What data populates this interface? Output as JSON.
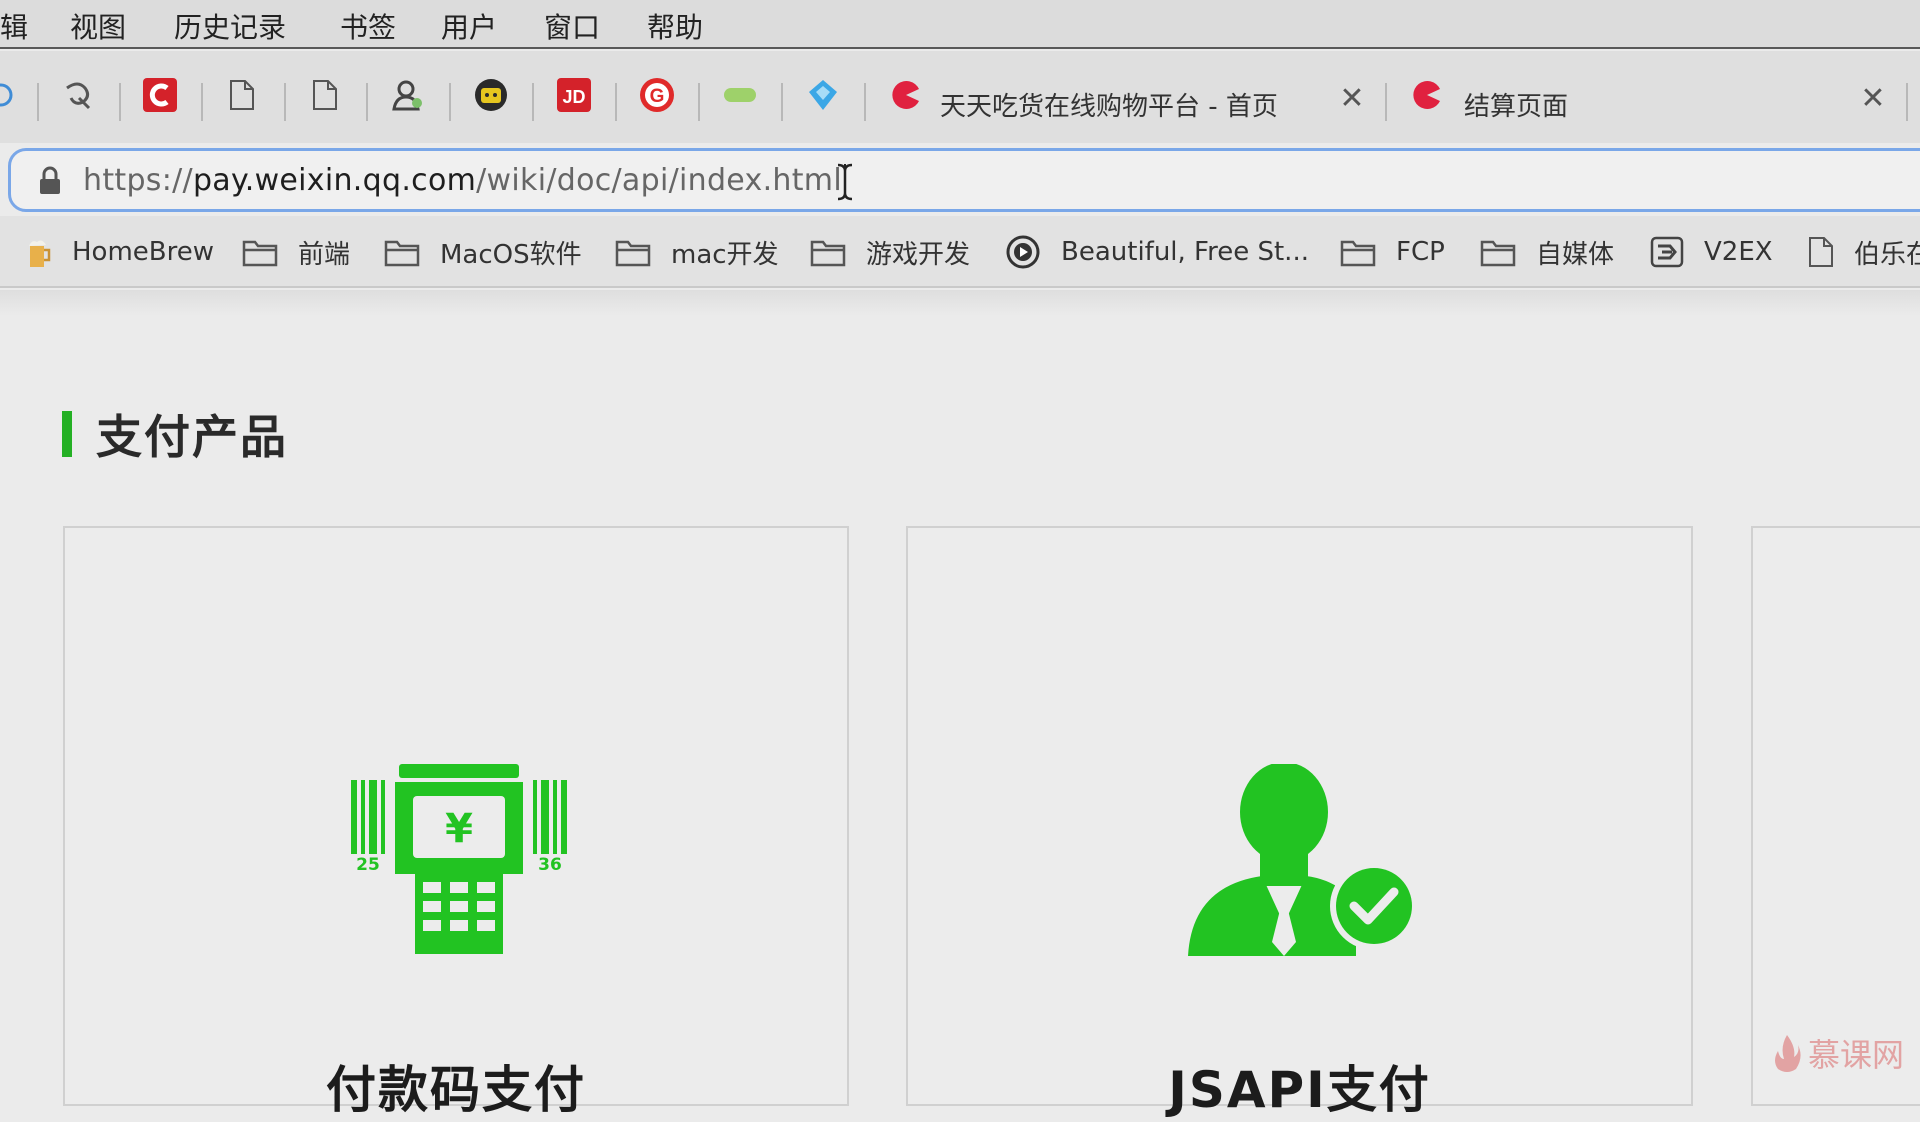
{
  "menubar": {
    "items": [
      "辑",
      "视图",
      "历史记录",
      "书签",
      "用户",
      "窗口",
      "帮助"
    ]
  },
  "tabs": [
    {
      "title": "天天吃货在线购物平台 - 首页",
      "close": "✕"
    },
    {
      "title": "结算页面",
      "close": "✕"
    }
  ],
  "address_bar": {
    "url_prefix": "https://",
    "url_host": "pay.weixin.qq.com",
    "url_path": "/wiki/doc/api/index.html"
  },
  "bookmarks": [
    {
      "label": "HomeBrew",
      "icon": "beer-icon"
    },
    {
      "label": "前端",
      "icon": "folder-icon"
    },
    {
      "label": "MacOS软件",
      "icon": "folder-icon"
    },
    {
      "label": "mac开发",
      "icon": "folder-icon"
    },
    {
      "label": "游戏开发",
      "icon": "folder-icon"
    },
    {
      "label": "Beautiful, Free St...",
      "icon": "play-circle-icon"
    },
    {
      "label": "FCP",
      "icon": "folder-icon"
    },
    {
      "label": "自媒体",
      "icon": "folder-icon"
    },
    {
      "label": "V2EX",
      "icon": "v2ex-icon"
    },
    {
      "label": "伯乐在",
      "icon": "page-icon"
    }
  ],
  "content": {
    "section_title": "支付产品",
    "cards": [
      {
        "title": "付款码支付",
        "icon": "pos-terminal-icon",
        "pos_numbers": [
          "25",
          "36"
        ],
        "currency": "¥"
      },
      {
        "title": "JSAPI支付",
        "icon": "verified-user-icon"
      }
    ]
  },
  "watermark": "慕课网",
  "colors": {
    "accent_green": "#22c322",
    "section_bar": "#24b024",
    "tab_icon_red": "#e0213f",
    "url_focus_border": "#7aa7e8"
  }
}
